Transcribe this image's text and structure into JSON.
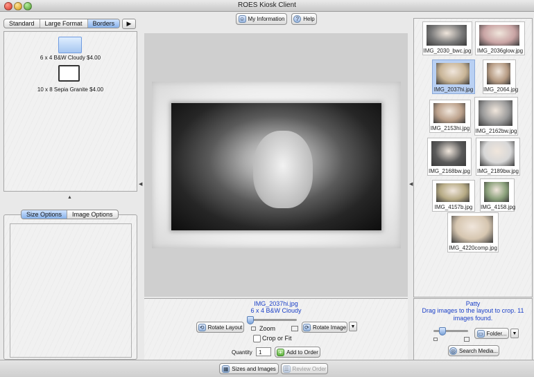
{
  "window": {
    "title": "ROES Kiosk Client"
  },
  "top_buttons": {
    "my_information": "My Information",
    "help": "Help"
  },
  "left_tabs": [
    "Standard",
    "Large Format",
    "Borders"
  ],
  "left_tab_selected": 2,
  "borders": [
    {
      "label": "6 x 4 B&W Cloudy $4.00"
    },
    {
      "label": "10 x 8 Sepia Granite $4.00"
    }
  ],
  "options_tabs": [
    "Size Options",
    "Image Options"
  ],
  "options_tab_selected": 0,
  "preview": {
    "filename": "IMG_2037hi.jpg",
    "product": "6 x 4 B&W Cloudy"
  },
  "controls": {
    "rotate_layout": "Rotate Layout",
    "zoom_label": "Zoom",
    "rotate_image": "Rotate Image",
    "crop_or_fit": "Crop or Fit",
    "quantity_label": "Quantity",
    "quantity_value": "1",
    "add_to_order": "Add to Order"
  },
  "thumbnails": [
    {
      "name": "IMG_2030_bwc.jpg",
      "selected": false
    },
    {
      "name": "IMG_2036glow.jpg",
      "selected": false
    },
    {
      "name": "IMG_2037hi.jpg",
      "selected": true
    },
    {
      "name": "IMG_2064.jpg",
      "selected": false
    },
    {
      "name": "IMG_2153hi.jpg",
      "selected": false
    },
    {
      "name": "IMG_2162bw.jpg",
      "selected": false
    },
    {
      "name": "IMG_2168bw.jpg",
      "selected": false
    },
    {
      "name": "IMG_2189bw.jpg",
      "selected": false
    },
    {
      "name": "IMG_4157b.jpg",
      "selected": false
    },
    {
      "name": "IMG_4158.jpg",
      "selected": false
    },
    {
      "name": "IMG_4220comp.jpg",
      "selected": false
    }
  ],
  "browser": {
    "folder_name": "Patty",
    "message": "Drag images to the layout to crop. 11 images found.",
    "folder_button": "Folder...",
    "search_media": "Search Media..."
  },
  "bottom": {
    "sizes_and_images": "Sizes and Images",
    "review_order": "Review Order"
  },
  "colors": {
    "accent": "#1a3fc7",
    "selection": "#b9d0f3",
    "tab_selected": "#87b2ea"
  }
}
